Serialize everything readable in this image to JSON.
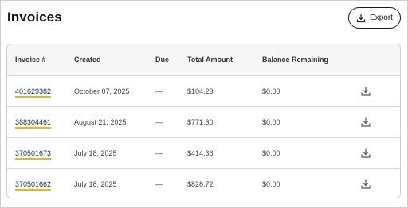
{
  "header": {
    "title": "Invoices",
    "export_label": "Export"
  },
  "table": {
    "columns": [
      "Invoice #",
      "Created",
      "Due",
      "Total Amount",
      "Balance Remaining"
    ],
    "rows": [
      {
        "invoice": "401629382",
        "created": "October 07, 2025",
        "due": "—",
        "total": "$104.23",
        "balance": "$0.00"
      },
      {
        "invoice": "388304461",
        "created": "August 21, 2025",
        "due": "—",
        "total": "$771.30",
        "balance": "$0.00"
      },
      {
        "invoice": "370501673",
        "created": "July 18, 2025",
        "due": "—",
        "total": "$414.36",
        "balance": "$0.00"
      },
      {
        "invoice": "370501662",
        "created": "July 18, 2025",
        "due": "—",
        "total": "$828.72",
        "balance": "$0.00"
      }
    ]
  },
  "colors": {
    "link": "#1a3a6e",
    "link_underline": "#f2b705",
    "header_bg": "#f6f6f6",
    "border": "#cfcfcf"
  },
  "icons": {
    "export": "download-icon",
    "row_action": "download-icon"
  }
}
